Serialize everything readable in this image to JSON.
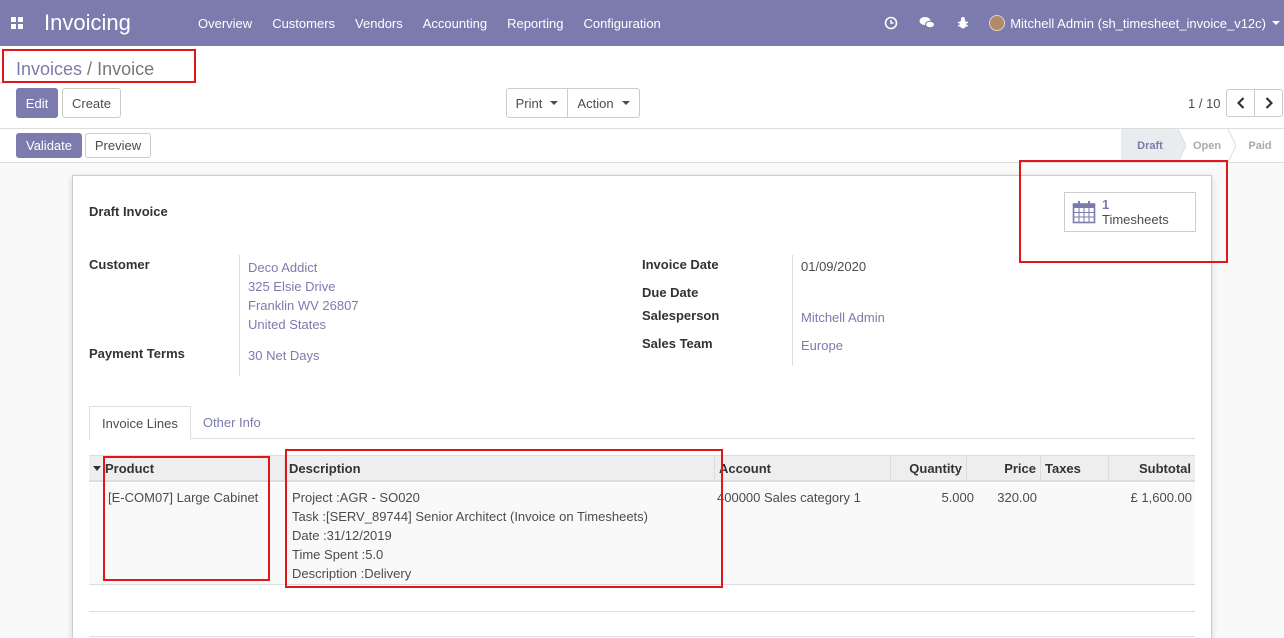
{
  "navbar": {
    "app_title": "Invoicing",
    "menu": [
      "Overview",
      "Customers",
      "Vendors",
      "Accounting",
      "Reporting",
      "Configuration"
    ],
    "user_name": "Mitchell Admin (sh_timesheet_invoice_v12c)"
  },
  "breadcrumb": {
    "parent": "Invoices",
    "separator": "/",
    "current": "Invoice"
  },
  "toolbar": {
    "edit": "Edit",
    "create": "Create",
    "print": "Print",
    "action": "Action",
    "pager": "1 / 10"
  },
  "statusbar": {
    "validate": "Validate",
    "preview": "Preview",
    "stages": [
      "Draft",
      "Open",
      "Paid"
    ]
  },
  "sheet": {
    "title": "Draft Invoice",
    "smart_button": {
      "count": "1",
      "label": "Timesheets"
    },
    "customer_label": "Customer",
    "customer_lines": [
      "Deco Addict",
      "325 Elsie Drive",
      "Franklin WV 26807",
      "United States"
    ],
    "payment_terms_label": "Payment Terms",
    "payment_terms": "30 Net Days",
    "invoice_date_label": "Invoice Date",
    "invoice_date": "01/09/2020",
    "due_date_label": "Due Date",
    "salesperson_label": "Salesperson",
    "salesperson": "Mitchell Admin",
    "sales_team_label": "Sales Team",
    "sales_team": "Europe"
  },
  "tabs": [
    "Invoice Lines",
    "Other Info"
  ],
  "table": {
    "headers": [
      "Product",
      "Description",
      "Account",
      "Quantity",
      "Price",
      "Taxes",
      "Subtotal"
    ],
    "row": {
      "product": "[E-COM07] Large Cabinet",
      "description": [
        "Project :AGR - SO020",
        "Task :[SERV_89744] Senior Architect (Invoice on Timesheets)",
        "Date :31/12/2019",
        "Time Spent :5.0",
        "Description :Delivery"
      ],
      "account": "400000 Sales category 1",
      "quantity": "5.000",
      "price": "320.00",
      "taxes": "",
      "subtotal": "£ 1,600.00"
    }
  },
  "colors": {
    "primary": "#7c7bad",
    "highlight": "#e0161b"
  }
}
